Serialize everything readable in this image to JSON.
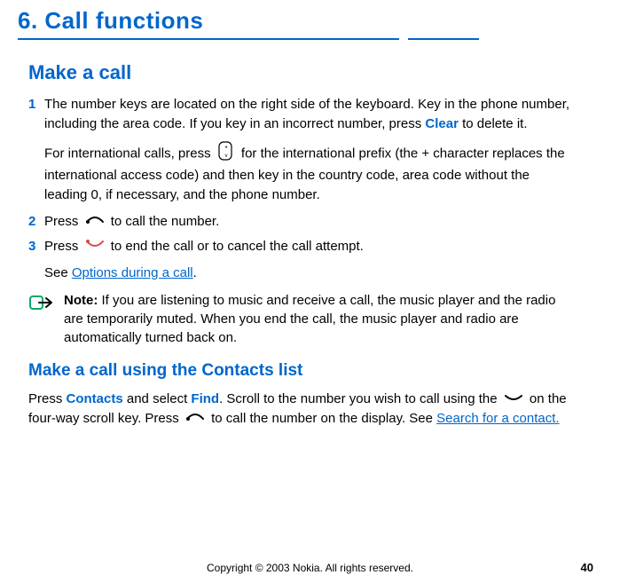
{
  "chapter": "6.  Call functions",
  "section1": {
    "heading": "Make a call",
    "step1": {
      "num": "1",
      "text1": "The number keys are located on the right side of the keyboard. Key in the phone number, including the area code. If you key in an incorrect number, press ",
      "kw1": "Clear",
      "text2": " to delete it.",
      "intl1": "For international calls, press ",
      "intl2": " for the international prefix (the + character replaces the international access code) and then key in the country code, area code without the leading 0, if necessary, and the phone number."
    },
    "step2": {
      "num": "2",
      "t1": "Press ",
      "t2": " to call the number."
    },
    "step3": {
      "num": "3",
      "t1": "Press ",
      "t2": " to end the call or to cancel the call attempt.",
      "see": "See ",
      "link": "Options during a call",
      "dot": "."
    },
    "note": {
      "label": "Note:",
      "text": " If you are listening to music and receive a call, the music player and the radio are temporarily muted. When you end the call, the music player and radio are automatically turned back on."
    }
  },
  "section2": {
    "heading": "Make a call using the Contacts list",
    "p1a": "Press ",
    "kw1": "Contacts",
    "p1b": " and select ",
    "kw2": "Find",
    "p1c": ". Scroll to the number you wish to call using the ",
    "p1d": " on the four-way scroll key. Press ",
    "p1e": " to call the number on the display. See ",
    "link": "Search for a contact.",
    "dot": ""
  },
  "footer": {
    "copyright": "Copyright © 2003 Nokia. All rights reserved.",
    "page": "40"
  }
}
